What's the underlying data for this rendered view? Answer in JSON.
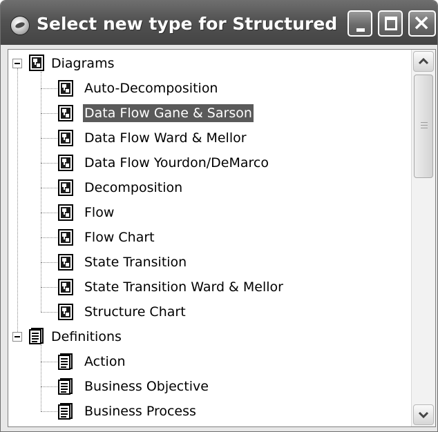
{
  "window": {
    "title": "Select new type for Structured",
    "app_icon": "app-globe-icon",
    "buttons": {
      "minimize": "minimize-icon",
      "maximize": "maximize-icon",
      "close": "close-icon"
    }
  },
  "tree": {
    "groups": [
      {
        "label": "Diagrams",
        "icon": "diagram-icon",
        "expanded": true,
        "items": [
          {
            "label": "Auto-Decomposition",
            "icon": "diagram-icon",
            "selected": false
          },
          {
            "label": "Data Flow Gane & Sarson",
            "icon": "diagram-icon",
            "selected": true
          },
          {
            "label": "Data Flow Ward & Mellor",
            "icon": "diagram-icon",
            "selected": false
          },
          {
            "label": "Data Flow Yourdon/DeMarco",
            "icon": "diagram-icon",
            "selected": false
          },
          {
            "label": "Decomposition",
            "icon": "diagram-icon",
            "selected": false
          },
          {
            "label": "Flow",
            "icon": "diagram-icon",
            "selected": false
          },
          {
            "label": "Flow Chart",
            "icon": "diagram-icon",
            "selected": false
          },
          {
            "label": "State Transition",
            "icon": "diagram-icon",
            "selected": false
          },
          {
            "label": "State Transition Ward & Mellor",
            "icon": "diagram-icon",
            "selected": false
          },
          {
            "label": "Structure Chart",
            "icon": "diagram-icon",
            "selected": false
          }
        ]
      },
      {
        "label": "Definitions",
        "icon": "definition-icon",
        "expanded": true,
        "items": [
          {
            "label": "Action",
            "icon": "definition-icon",
            "selected": false
          },
          {
            "label": "Business Objective",
            "icon": "definition-icon",
            "selected": false
          },
          {
            "label": "Business Process",
            "icon": "definition-icon",
            "selected": false
          }
        ]
      }
    ]
  },
  "scrollbar": {
    "up": "scroll-up-arrow-icon",
    "down": "scroll-down-arrow-icon"
  },
  "colors": {
    "titlebar": "#525252",
    "selection": "#5a5a5a",
    "tree_background": "#ffffff"
  }
}
